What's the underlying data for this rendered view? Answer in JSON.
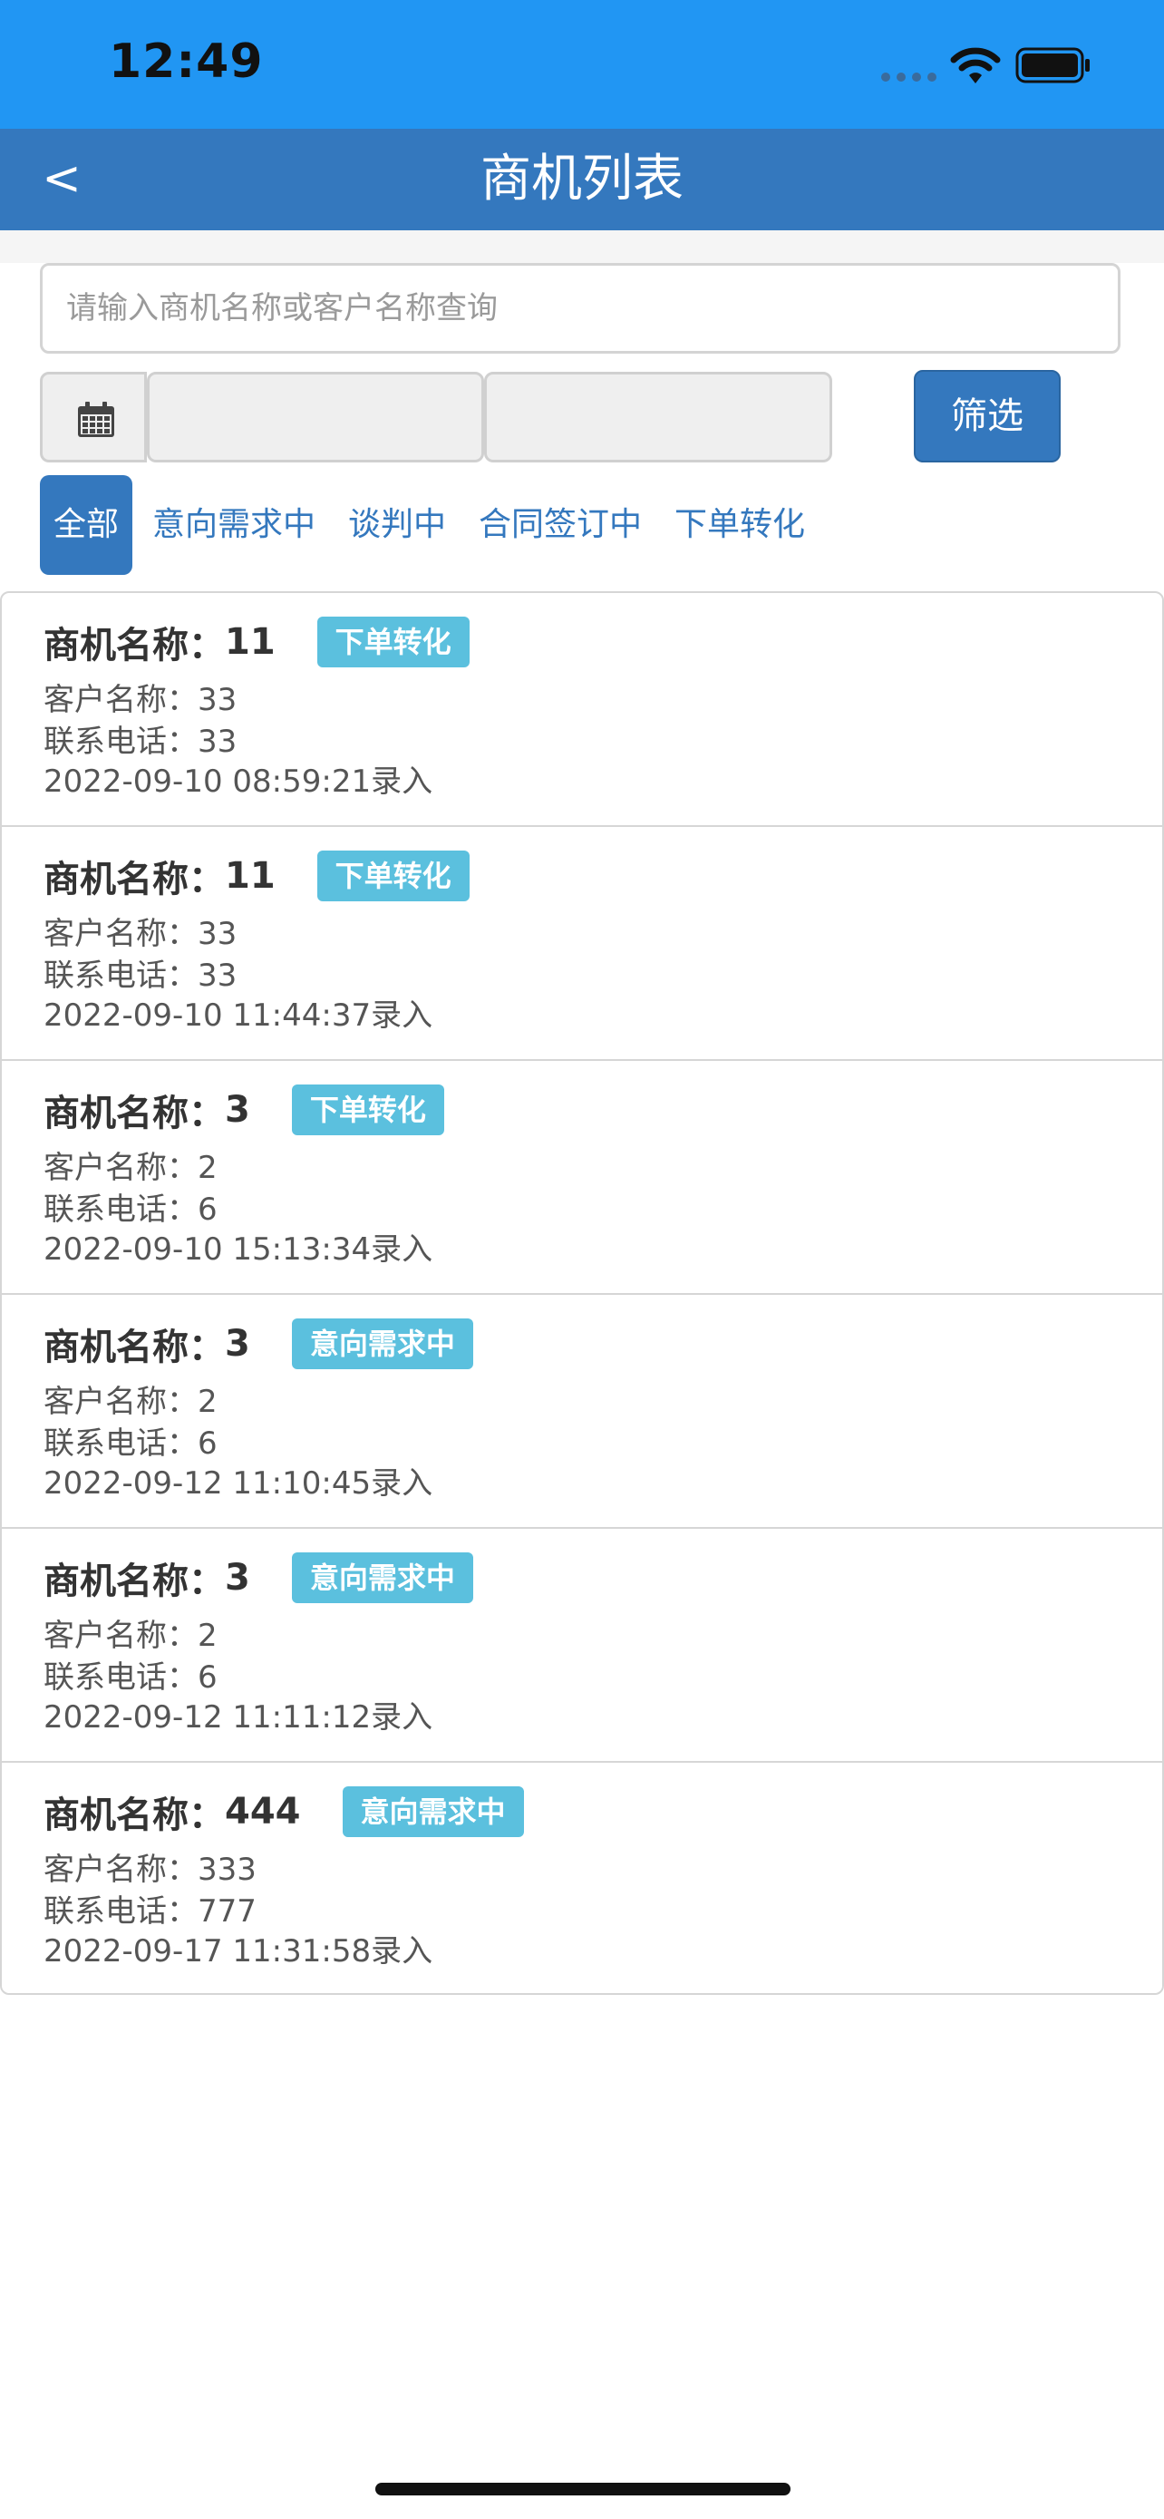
{
  "status_bar": {
    "time": "12:49"
  },
  "nav": {
    "back_label": "<",
    "title": "商机列表"
  },
  "search": {
    "placeholder": "请输入商机名称或客户名称查询",
    "value": ""
  },
  "date_range": {
    "start_value": "",
    "end_value": ""
  },
  "filter_button": {
    "label": "筛选"
  },
  "tabs": [
    {
      "label": "全部",
      "active": true
    },
    {
      "label": "意向需求中",
      "active": false
    },
    {
      "label": "谈判中",
      "active": false
    },
    {
      "label": "合同签订中",
      "active": false
    },
    {
      "label": "下单转化",
      "active": false
    }
  ],
  "opportunities": [
    {
      "name_label": "商机名称：",
      "name": "11",
      "status": "下单转化",
      "customer_line": "客户名称：33",
      "phone_line": "联系电话：33",
      "entry_line": "2022-09-10 08:59:21录入"
    },
    {
      "name_label": "商机名称：",
      "name": "11",
      "status": "下单转化",
      "customer_line": "客户名称：33",
      "phone_line": "联系电话：33",
      "entry_line": "2022-09-10 11:44:37录入"
    },
    {
      "name_label": "商机名称：",
      "name": "3",
      "status": "下单转化",
      "customer_line": "客户名称：2",
      "phone_line": "联系电话：6",
      "entry_line": "2022-09-10 15:13:34录入"
    },
    {
      "name_label": "商机名称：",
      "name": "3",
      "status": "意向需求中",
      "customer_line": "客户名称：2",
      "phone_line": "联系电话：6",
      "entry_line": "2022-09-12 11:10:45录入"
    },
    {
      "name_label": "商机名称：",
      "name": "3",
      "status": "意向需求中",
      "customer_line": "客户名称：2",
      "phone_line": "联系电话：6",
      "entry_line": "2022-09-12 11:11:12录入"
    },
    {
      "name_label": "商机名称：",
      "name": "444",
      "status": "意向需求中",
      "customer_line": "客户名称：333",
      "phone_line": "联系电话：777",
      "entry_line": "2022-09-17 11:31:58录入"
    }
  ],
  "colors": {
    "status_bar": "#2196f3",
    "primary": "#3478be",
    "badge": "#5bc0de"
  },
  "icons": {
    "back": "back-chevron-icon",
    "calendar": "calendar-icon",
    "wifi": "wifi-icon",
    "battery": "battery-icon",
    "signal": "signal-dots-icon"
  }
}
